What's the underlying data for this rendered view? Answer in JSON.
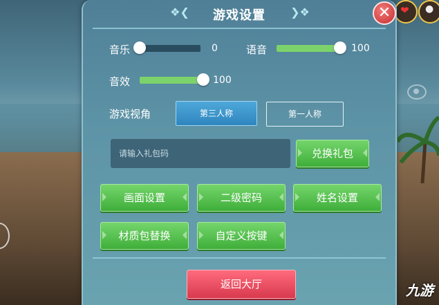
{
  "panel": {
    "title": "游戏设置",
    "close_label": "✕"
  },
  "audio": {
    "music": {
      "label": "音乐",
      "value": "0",
      "level": 0
    },
    "voice": {
      "label": "语音",
      "value": "100",
      "level": 100
    },
    "sfx": {
      "label": "音效",
      "value": "100",
      "level": 100
    }
  },
  "camera": {
    "label": "游戏视角",
    "options": [
      "第三人称",
      "第一人称"
    ],
    "selected": "第三人称"
  },
  "gift": {
    "placeholder": "请输入礼包码",
    "redeem_label": "兑换礼包"
  },
  "buttons": {
    "graphics": "画面设置",
    "secondary_password": "二级密码",
    "name_settings": "姓名设置",
    "texture_pack": "材质包替换",
    "custom_keys": "自定义按键",
    "return_lobby": "返回大厅"
  },
  "watermark": "九游",
  "colors": {
    "accent_green": "#5cc352",
    "danger_red": "#e64a5c",
    "panel_blue": "#5d93a6"
  }
}
